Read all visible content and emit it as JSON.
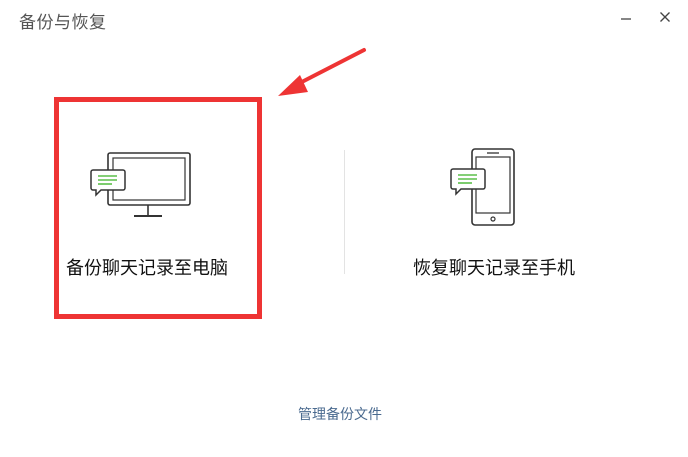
{
  "window": {
    "title": "备份与恢复"
  },
  "options": {
    "backup": {
      "label": "备份聊天记录至电脑",
      "icon": "monitor-chat-icon"
    },
    "restore": {
      "label": "恢复聊天记录至手机",
      "icon": "phone-chat-icon"
    }
  },
  "footer": {
    "manage_link": "管理备份文件"
  },
  "colors": {
    "highlight": "#ee3434",
    "chat_bubble": "#5cbf4a",
    "link": "#4a6a8f",
    "divider": "#e3e3e3"
  }
}
